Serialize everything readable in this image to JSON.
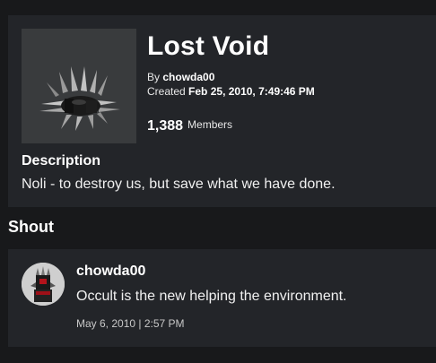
{
  "group": {
    "name": "Lost Void",
    "by_label": "By",
    "owner": "chowda00",
    "created_label": "Created",
    "created": "Feb 25, 2010, 7:49:46 PM",
    "member_count": "1,388",
    "members_label": "Members",
    "description_heading": "Description",
    "description": "Noli - to destroy us, but save what we have done.",
    "emblem_icon": "spiked-crown-emblem"
  },
  "shout": {
    "heading": "Shout",
    "poster": "chowda00",
    "message": "Occult is the new helping the environment.",
    "date": "May 6, 2010 | 2:57 PM",
    "avatar_icon": "user-avatar"
  },
  "colors": {
    "page_bg": "#18191b",
    "panel_bg": "#232529",
    "thumb_bg": "#393b3d",
    "text": "#ffffff"
  }
}
